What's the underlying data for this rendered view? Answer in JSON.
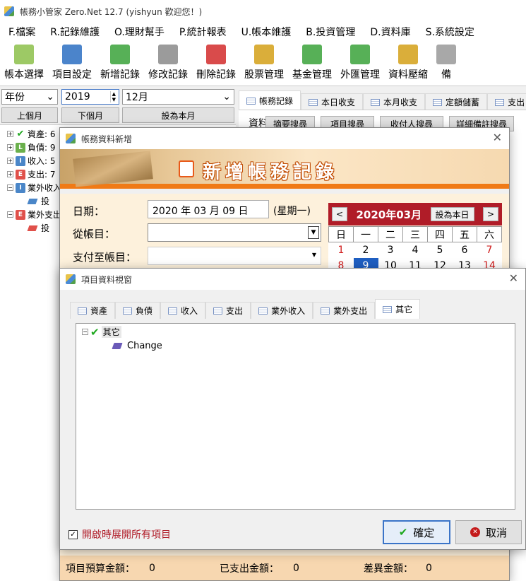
{
  "window": {
    "title": "帳務小管家 Zero.Net 12.7 (yishyun 歡迎您！)"
  },
  "menu": [
    "F.檔案",
    "R.記錄維護",
    "O.理財幫手",
    "P.統計報表",
    "U.帳本維護",
    "B.投資管理",
    "D.資料庫",
    "S.系統設定"
  ],
  "toolbar": [
    {
      "label": "帳本選擇",
      "icon": "books-icon",
      "color": "#8cc04a"
    },
    {
      "label": "項目設定",
      "icon": "calculator-icon",
      "color": "#2b6fc2"
    },
    {
      "label": "新增記錄",
      "icon": "add-icon",
      "color": "#3aa23a"
    },
    {
      "label": "修改記錄",
      "icon": "edit-icon",
      "color": "#8a8a8a"
    },
    {
      "label": "刪除記錄",
      "icon": "delete-icon",
      "color": "#d22b2b"
    },
    {
      "label": "股票管理",
      "icon": "stock-icon",
      "color": "#d4a017"
    },
    {
      "label": "基金管理",
      "icon": "fund-icon",
      "color": "#3aa23a"
    },
    {
      "label": "外匯管理",
      "icon": "forex-icon",
      "color": "#3aa23a"
    },
    {
      "label": "資料壓縮",
      "icon": "compress-icon",
      "color": "#d4a017"
    },
    {
      "label": "備",
      "icon": "backup-icon",
      "color": "#999999"
    }
  ],
  "filter": {
    "period_type": "年份",
    "year": "2019",
    "month": "12月",
    "prev_label": "上個月",
    "next_label": "下個月",
    "set_label": "設為本月"
  },
  "tree": [
    {
      "label": "資產: 6",
      "badge": "✔",
      "color": "#1ea81e",
      "check": true
    },
    {
      "label": "負債: 9",
      "badge": "L",
      "color": "#6ab04c"
    },
    {
      "label": "收入: 5",
      "badge": "I",
      "color": "#4a86c8"
    },
    {
      "label": "支出: 7",
      "badge": "E",
      "color": "#e0504a"
    },
    {
      "label": "業外收入",
      "badge": "I",
      "color": "#4a86c8"
    },
    {
      "label": "投",
      "child": true,
      "color": "#4a86c8"
    },
    {
      "label": "業外支出",
      "badge": "E",
      "color": "#e0504a"
    },
    {
      "label": "投",
      "child": true,
      "color": "#e0504a"
    }
  ],
  "main_tabs": [
    "帳務記錄",
    "本日收支",
    "本月收支",
    "定額儲蓄",
    "支出"
  ],
  "search": {
    "prefix": "資料",
    "buttons": [
      "摘要搜尋",
      "項目搜尋",
      "收付人搜尋",
      "詳細備註搜尋"
    ]
  },
  "record_dialog": {
    "title": "帳務資料新增",
    "banner": "新增帳務記錄",
    "date_label": "日期：",
    "date_value": "2020 年 03 月 09 日",
    "weekday": "(星期一)",
    "from_label": "從帳目：",
    "to_label": "支付至帳目：",
    "calendar": {
      "month": "2020年03月",
      "today_btn": "設為本日",
      "prev": "<",
      "next": ">",
      "weekdays": [
        "日",
        "一",
        "二",
        "三",
        "四",
        "五",
        "六"
      ],
      "row1": [
        "1",
        "2",
        "3",
        "4",
        "5",
        "6",
        "7"
      ],
      "row2": [
        "8",
        "9",
        "10",
        "11",
        "12",
        "13",
        "14"
      ]
    },
    "footer": {
      "budget_label": "項目預算金額：",
      "budget": "0",
      "spent_label": "已支出金額：",
      "spent": "0",
      "diff_label": "差異金額：",
      "diff": "0"
    }
  },
  "item_dialog": {
    "title": "項目資料視窗",
    "tabs": [
      "資產",
      "負債",
      "收入",
      "支出",
      "業外收入",
      "業外支出",
      "其它"
    ],
    "tree_root": "其它",
    "tree_child": "Change",
    "checkbox_label": "開啟時展開所有項目",
    "ok_label": "確定",
    "cancel_label": "取消"
  }
}
